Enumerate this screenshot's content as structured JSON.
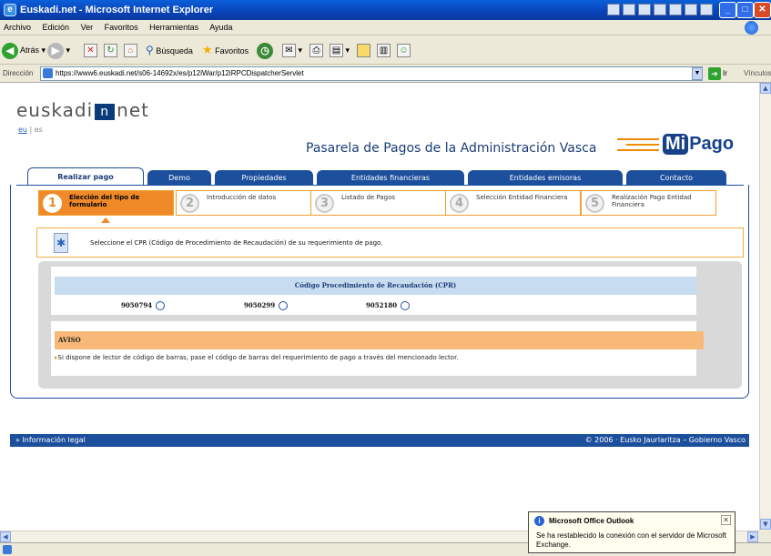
{
  "window": {
    "title": "Euskadi.net - Microsoft Internet Explorer"
  },
  "menu": [
    "Archivo",
    "Edición",
    "Ver",
    "Favoritos",
    "Herramientas",
    "Ayuda"
  ],
  "toolbar": {
    "back": "Atrás",
    "search": "Búsqueda",
    "favorites": "Favoritos"
  },
  "address": {
    "label": "Dirección",
    "url": "https://www6.euskadi.net/s06-14692x/es/p12iWar/p12iRPCDispatcherServlet",
    "go": "Ir",
    "links": "Vínculos"
  },
  "page": {
    "logo_left": "euskadi",
    "logo_mark": "n",
    "logo_right": "net",
    "lang_eu": "eu",
    "lang_sep": "|",
    "lang_es": "es",
    "title": "Pasarela de Pagos de la Administración Vasca",
    "brand_mi": "Mi",
    "brand_pago": "Pago",
    "tabs": [
      "Realizar pago",
      "Demo",
      "Propiedades",
      "Entidades financieras",
      "Entidades emisoras",
      "Contacto"
    ],
    "steps": [
      {
        "num": "1",
        "label": "Elección del tipo de formulario"
      },
      {
        "num": "2",
        "label": "Introducción de datos"
      },
      {
        "num": "3",
        "label": "Listado de Pagos"
      },
      {
        "num": "4",
        "label": "Selección Entidad Financiera"
      },
      {
        "num": "5",
        "label": "Realización Pago Entidad Financiera"
      }
    ],
    "instruction": "Seleccione el CPR (Código de Procedimiento de Recaudación) de su requerimiento de pago.",
    "cpr_header": "Código Procedimiento de Recaudación (CPR)",
    "cpr_options": [
      "9050794",
      "9050299",
      "9052180"
    ],
    "aviso_title": "AVISO",
    "aviso_text": "Si dispone de lector de código de barras, pase el código de barras del requerimiento de pago a través del mencionado lector.",
    "footer_left": "» Información legal",
    "footer_right": "© 2006 · Eusko Jaurlaritza – Gobierno Vasco"
  },
  "popup": {
    "title": "Microsoft Office Outlook",
    "message": "Se ha restablecido la conexión con el servidor de Microsoft Exchange."
  },
  "colors": {
    "brand_blue": "#1c4f9c",
    "accent_orange": "#f08a28",
    "aviso_bg": "#f8b878"
  }
}
